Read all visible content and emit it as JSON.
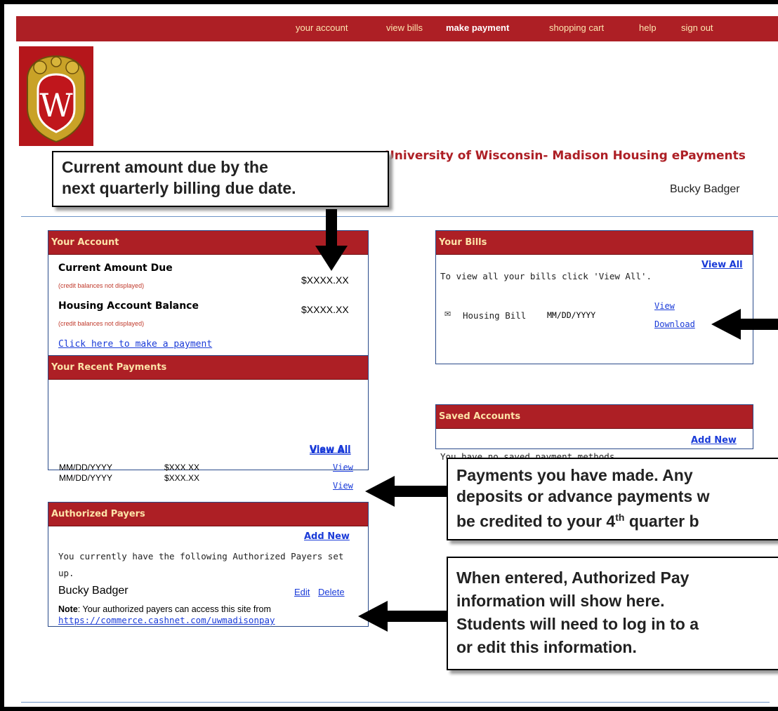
{
  "nav": {
    "items": [
      {
        "label": "your account",
        "active": false
      },
      {
        "label": "view bills",
        "active": false
      },
      {
        "label": "make payment",
        "active": true
      },
      {
        "label": "shopping cart",
        "active": false
      },
      {
        "label": "help",
        "active": false
      },
      {
        "label": "sign out",
        "active": false
      }
    ]
  },
  "header": {
    "title": "University of Wisconsin- Madison Housing ePayments",
    "user": "Bucky Badger",
    "crest_letter": "W"
  },
  "your_account": {
    "title": "Your Account",
    "current_label": "Current Amount Due",
    "current_note": "(credit balances not displayed)",
    "current_value": "$XXXX.XX",
    "balance_label": "Housing Account Balance",
    "balance_note": "(credit balances not displayed)",
    "balance_value": "$XXXX.XX",
    "pay_link": "Click here to make a payment"
  },
  "recent_payments": {
    "title": "Your Recent Payments",
    "view_all": "View All",
    "rows": [
      {
        "date": "MM/DD/YYYY",
        "amount": "$XXX.XX",
        "link": "View"
      },
      {
        "date": "MM/DD/YYYY",
        "amount": "$XXX.XX",
        "link": "View"
      }
    ]
  },
  "authorized_payers": {
    "title": "Authorized Payers",
    "add_new": "Add New",
    "intro_line1": "You currently have the following Authorized Payers set",
    "intro_line2": "up.",
    "payer": "Bucky Badger",
    "edit": "Edit",
    "delete": "Delete",
    "note_label": "Note",
    "note_text": ": Your authorized payers can access this site from",
    "note_url": "https://commerce.cashnet.com/uwmadisonpay"
  },
  "your_bills": {
    "title": "Your Bills",
    "view_all": "View All",
    "intro": "To view all your bills click 'View All'.",
    "bill_name": "Housing Bill",
    "bill_date": "MM/DD/YYYY",
    "view": "View",
    "download": "Download"
  },
  "saved_accounts": {
    "title": "Saved Accounts",
    "add_new": "Add New",
    "empty": "You have no saved payment methods."
  },
  "callouts": {
    "amount_due": {
      "line1": "Current amount due by the",
      "line2": "next quarterly billing due date."
    },
    "payments": {
      "line1": "Payments you have made. Any",
      "line2": "deposits or advance payments w",
      "line3_a": "be credited to your 4",
      "line3_sup": "th",
      "line3_b": " quarter b"
    },
    "payers": {
      "line1": "When entered, Authorized Pay",
      "line2": "information will show here.",
      "line3": "Students will need to log in to a",
      "line4": "or edit this information."
    }
  },
  "colors": {
    "brand_red": "#ad1f25",
    "nav_text": "#fde6b0",
    "link_blue": "#1a3bd8",
    "rule_blue": "#6d93c6"
  }
}
